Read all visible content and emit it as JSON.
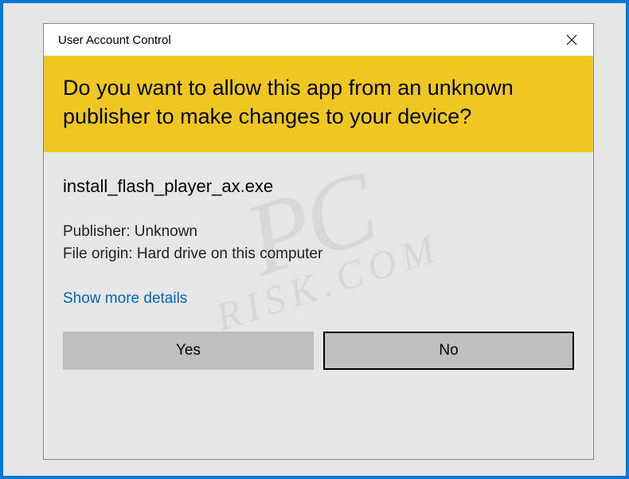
{
  "titlebar": {
    "title": "User Account Control"
  },
  "header": {
    "question": "Do you want to allow this app from an unknown publisher to make changes to your device?"
  },
  "body": {
    "app_name": "install_flash_player_ax.exe",
    "publisher_label": "Publisher: ",
    "publisher_value": "Unknown",
    "origin_label": "File origin: ",
    "origin_value": "Hard drive on this computer",
    "details_link": "Show more details"
  },
  "buttons": {
    "yes": "Yes",
    "no": "No"
  },
  "watermark": {
    "main": "PC",
    "sub": "RISK.COM"
  }
}
